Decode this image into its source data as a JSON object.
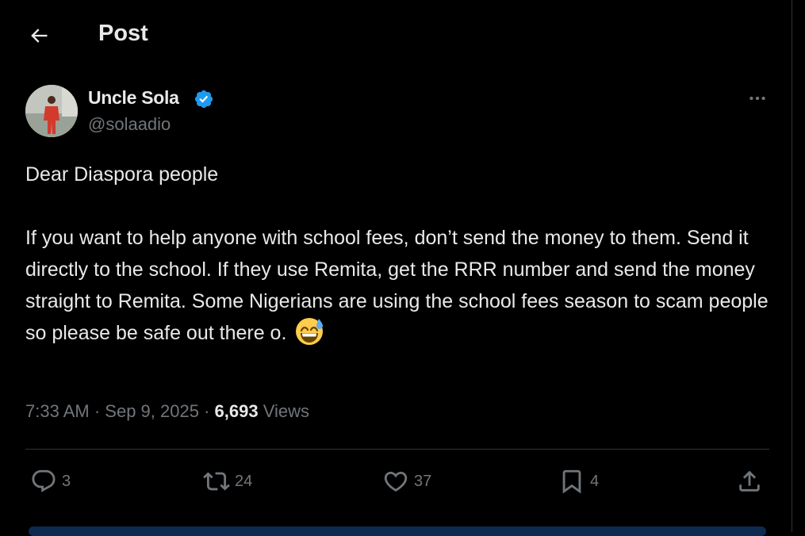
{
  "header": {
    "title": "Post"
  },
  "author": {
    "display_name": "Uncle Sola",
    "handle": "@solaadio",
    "verified": true
  },
  "tweet": {
    "paragraph_1": "Dear Diaspora people",
    "paragraph_2": "If you want to help anyone with school fees, don’t send the money to them. Send it directly to the school. If they use Remita, get the RRR number and send the money straight to Remita. Some Nigerians are using the school fees season to scam people so please be safe out there o."
  },
  "meta": {
    "time": "7:33 AM",
    "separator": "·",
    "date": "Sep 9, 2025",
    "views_count": "6,693",
    "views_label": "Views"
  },
  "actions": {
    "replies": "3",
    "reposts": "24",
    "likes": "37",
    "bookmarks": "4"
  },
  "icons": [
    "back-arrow-icon",
    "verified-badge-icon",
    "more-icon",
    "reply-icon",
    "repost-icon",
    "like-icon",
    "bookmark-icon",
    "share-icon",
    "grinning-sweat-emoji"
  ],
  "colors": {
    "background": "#000000",
    "text": "#e7e9ea",
    "secondary": "#71767b",
    "verified": "#1d9bf0",
    "border": "#2f3336"
  }
}
